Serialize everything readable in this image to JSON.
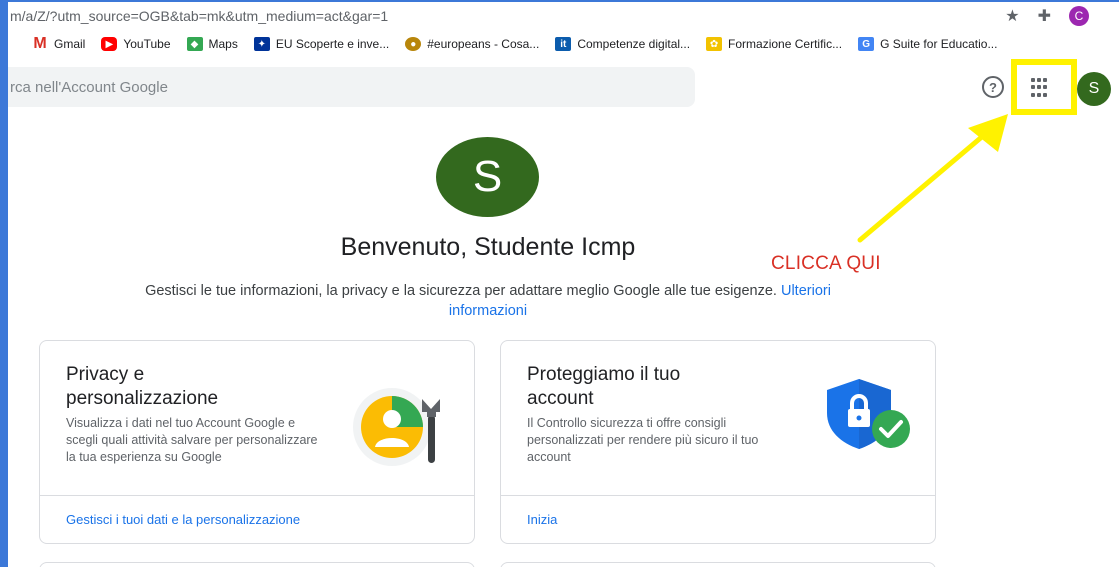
{
  "browser": {
    "url_fragment": "m/a/Z/?utm_source=OGB&tab=mk&utm_medium=act&gar=1",
    "profile_initial": "C"
  },
  "bookmarks": [
    {
      "label": "Gmail",
      "icon": "gmail-icon",
      "glyph": "M"
    },
    {
      "label": "YouTube",
      "icon": "youtube-icon",
      "glyph": "▶"
    },
    {
      "label": "Maps",
      "icon": "maps-icon",
      "glyph": "◆"
    },
    {
      "label": "EU Scoperte e inve...",
      "icon": "eu-flag-icon",
      "glyph": "✦"
    },
    {
      "label": "#europeans - Cosa...",
      "icon": "europeans-icon",
      "glyph": "●"
    },
    {
      "label": "Competenze digital...",
      "icon": "it-icon",
      "glyph": "it"
    },
    {
      "label": "Formazione Certific...",
      "icon": "formazione-icon",
      "glyph": "✿"
    },
    {
      "label": "G Suite for Educatio...",
      "icon": "gsuite-icon",
      "glyph": "G"
    }
  ],
  "header": {
    "search_placeholder": "rca nell'Account Google",
    "help_glyph": "?",
    "avatar_initial": "S"
  },
  "annotation": {
    "callout_text": "CLICCA QUI",
    "highlight_color": "#fff200",
    "callout_color": "#d93025"
  },
  "profile": {
    "avatar_initial": "S",
    "welcome": "Benvenuto, Studente Icmp",
    "subtitle_text": "Gestisci le tue informazioni, la privacy e la sicurezza per adattare meglio Google alle tue esigenze.",
    "subtitle_link_1": "Ulteriori",
    "subtitle_link_2": "informazioni"
  },
  "cards": [
    {
      "title_line1": "Privacy e",
      "title_line2": "personalizzazione",
      "description": "Visualizza i dati nel tuo Account Google e scegli quali attività salvare per personalizzare la tua esperienza su Google",
      "link": "Gestisci i tuoi dati e la personalizzazione",
      "illustration": "privacy-illustration-icon"
    },
    {
      "title_line1": "Proteggiamo il tuo",
      "title_line2": "account",
      "description": "Il Controllo sicurezza ti offre consigli personalizzati per rendere più sicuro il tuo account",
      "link": "Inizia",
      "illustration": "security-shield-icon"
    }
  ],
  "colors": {
    "accent": "#1a73e8",
    "avatar": "#33691e",
    "frame": "#3c78d8"
  }
}
